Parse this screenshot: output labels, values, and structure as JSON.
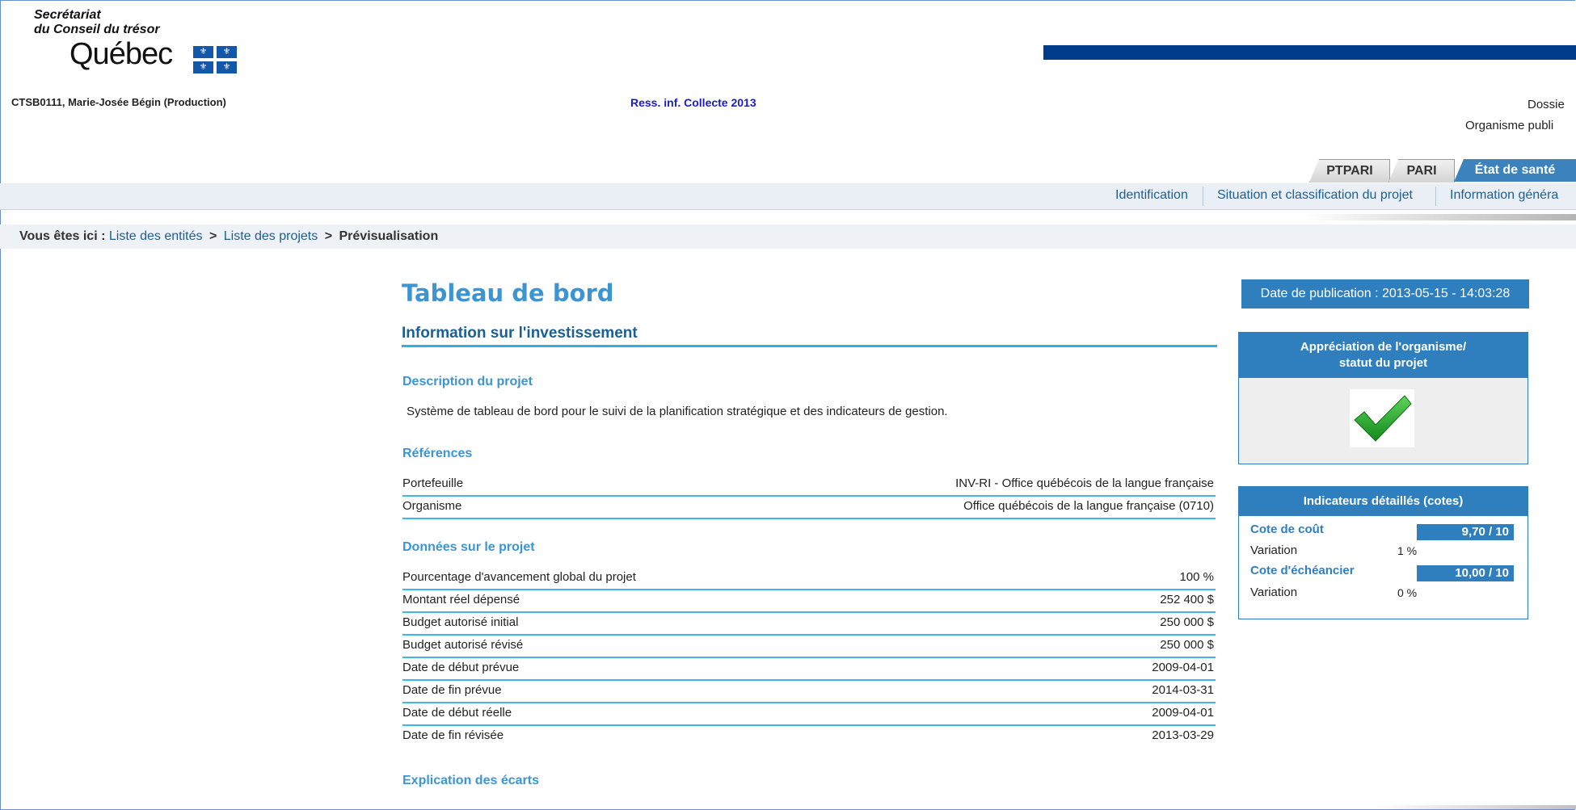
{
  "header": {
    "logo_line1": "Secrétariat",
    "logo_line2": "du Conseil du trésor",
    "logo_name": "Québec",
    "user": "CTSB0111, Marie-Josée Bégin (Production)",
    "collection": "Ress. inf. Collecte 2013",
    "dossier_label": "Dossie",
    "organisme_label": "Organisme publi"
  },
  "tabs": [
    {
      "label": "PTPARI"
    },
    {
      "label": "PARI"
    },
    {
      "label": "État de santé"
    }
  ],
  "subnav": [
    {
      "label": "Identification"
    },
    {
      "label": "Situation et classification du projet"
    },
    {
      "label": "Information généra"
    }
  ],
  "breadcrumb": {
    "prefix": "Vous êtes ici :",
    "items": [
      "Liste des entités",
      "Liste des projets"
    ],
    "current": "Prévisualisation",
    "separator": ">"
  },
  "main": {
    "title": "Tableau de bord",
    "section_title": "Information sur l'investissement",
    "description_heading": "Description du projet",
    "description": "Système de tableau de bord pour le suivi de la planification stratégique et des indicateurs de gestion.",
    "references_heading": "Références",
    "references": [
      {
        "label": "Portefeuille",
        "value": "INV-RI - Office québécois de la langue française"
      },
      {
        "label": "Organisme",
        "value": "Office québécois de la langue française (0710)"
      }
    ],
    "project_data_heading": "Données sur le projet",
    "project_data": [
      {
        "label": "Pourcentage d'avancement global du projet",
        "value": "100 %"
      },
      {
        "label": "Montant réel dépensé",
        "value": "252 400 $"
      },
      {
        "label": "Budget autorisé initial",
        "value": "250 000 $"
      },
      {
        "label": "Budget autorisé révisé",
        "value": "250 000 $"
      },
      {
        "label": "Date de début prévue",
        "value": "2009-04-01"
      },
      {
        "label": "Date de fin prévue",
        "value": "2014-03-31"
      },
      {
        "label": "Date de début réelle",
        "value": "2009-04-01"
      },
      {
        "label": "Date de fin révisée",
        "value": "2013-03-29"
      }
    ],
    "gaps_heading": "Explication des écarts"
  },
  "side": {
    "publication": "Date de publication : 2013-05-15 - 14:03:28",
    "appreciation_line1": "Appréciation de l'organisme/",
    "appreciation_line2": "statut du projet",
    "status_icon": "checkmark-icon",
    "indicators_title": "Indicateurs détaillés (cotes)",
    "cost_label": "Cote de coût",
    "cost_value": "9,70 / 10",
    "cost_variation_label": "Variation",
    "cost_variation": "1 %",
    "schedule_label": "Cote d'échéancier",
    "schedule_value": "10,00 / 10",
    "schedule_variation_label": "Variation",
    "schedule_variation": "0 %"
  },
  "colors": {
    "accent": "#2f7fbf",
    "title_blue": "#3c95d0",
    "row_line": "#3bb6e6",
    "topbar": "#003b8c",
    "check_green": "#22a32a"
  }
}
